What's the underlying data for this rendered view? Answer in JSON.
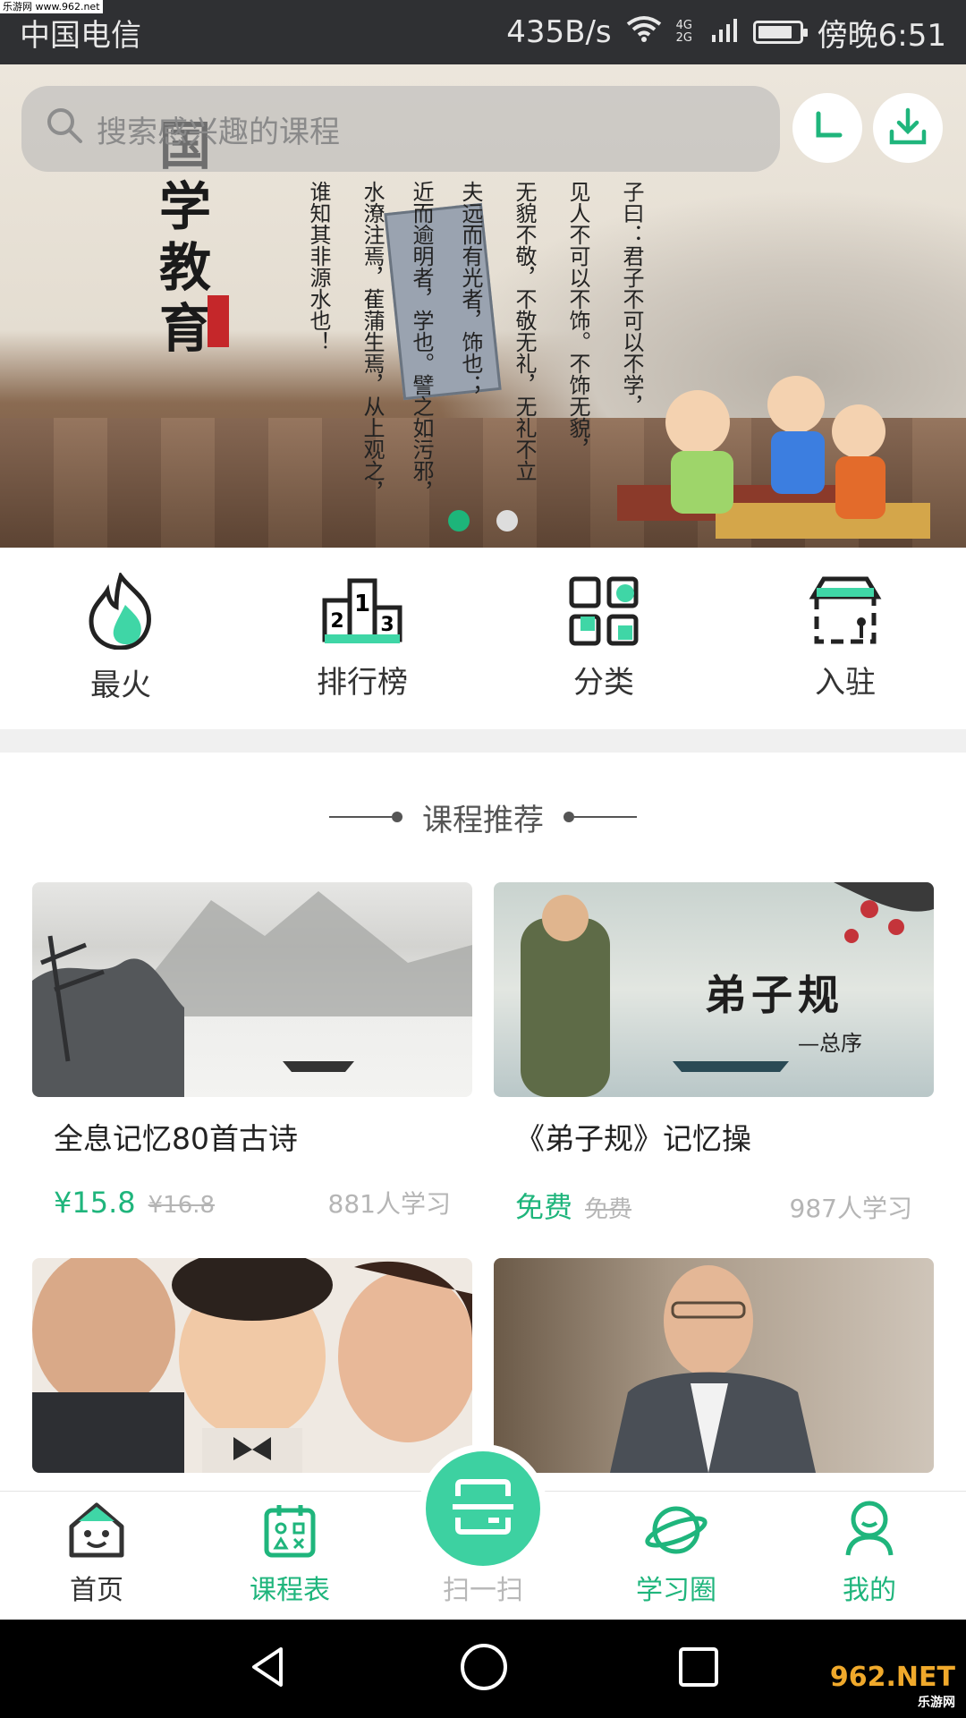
{
  "status_bar": {
    "carrier": "中国电信",
    "speed": "435B/s",
    "network": "4G\n2G",
    "time": "傍晚6:51",
    "corner_watermark": "乐游网 www.962.net",
    "battery_level": 0.85
  },
  "search": {
    "placeholder": "搜索感兴趣的课程"
  },
  "banner": {
    "brand": "国学教育",
    "poem_lines": [
      "子曰：君子不可以不学，",
      "见人不可以不饰。不饰无貌，",
      "无貌不敬，不敬无礼，无礼不立",
      "夫远而有光者，饰也；",
      "近而逾明者，学也。譬之如污邪，",
      "水潦注焉，萑蒲生焉，从上观之，",
      "谁知其非源水也！"
    ],
    "active_slide": 1,
    "slide_count": 2
  },
  "quick_nav": [
    {
      "label": "最火",
      "icon": "fire-icon"
    },
    {
      "label": "排行榜",
      "icon": "podium-icon"
    },
    {
      "label": "分类",
      "icon": "category-grid-icon"
    },
    {
      "label": "入驻",
      "icon": "storefront-icon"
    }
  ],
  "section": {
    "title": "课程推荐"
  },
  "courses": [
    {
      "title": "全息记忆80首古诗",
      "price": "¥15.8",
      "old_price": "¥16.8",
      "students": "881人学习"
    },
    {
      "title": "《弟子规》记忆操",
      "price": "免费",
      "old_price": "免费",
      "students": "987人学习",
      "thumb_caption": "弟子规",
      "thumb_sub": "—总序"
    },
    {
      "title": "",
      "price": "",
      "old_price": "",
      "students": ""
    },
    {
      "title": "",
      "price": "",
      "old_price": "",
      "students": ""
    }
  ],
  "tabbar": {
    "items": [
      {
        "label": "首页",
        "icon": "home-face-icon"
      },
      {
        "label": "课程表",
        "icon": "calendar-icon"
      },
      {
        "label": "扫一扫",
        "icon": "scan-icon"
      },
      {
        "label": "学习圈",
        "icon": "planet-icon"
      },
      {
        "label": "我的",
        "icon": "user-icon"
      }
    ],
    "colors": {
      "accent": "#1fb57c",
      "inactive": "#333333",
      "scan_label": "#b8b8b8"
    }
  },
  "watermark": {
    "brand": "962.NET",
    "sub": "乐游网"
  }
}
